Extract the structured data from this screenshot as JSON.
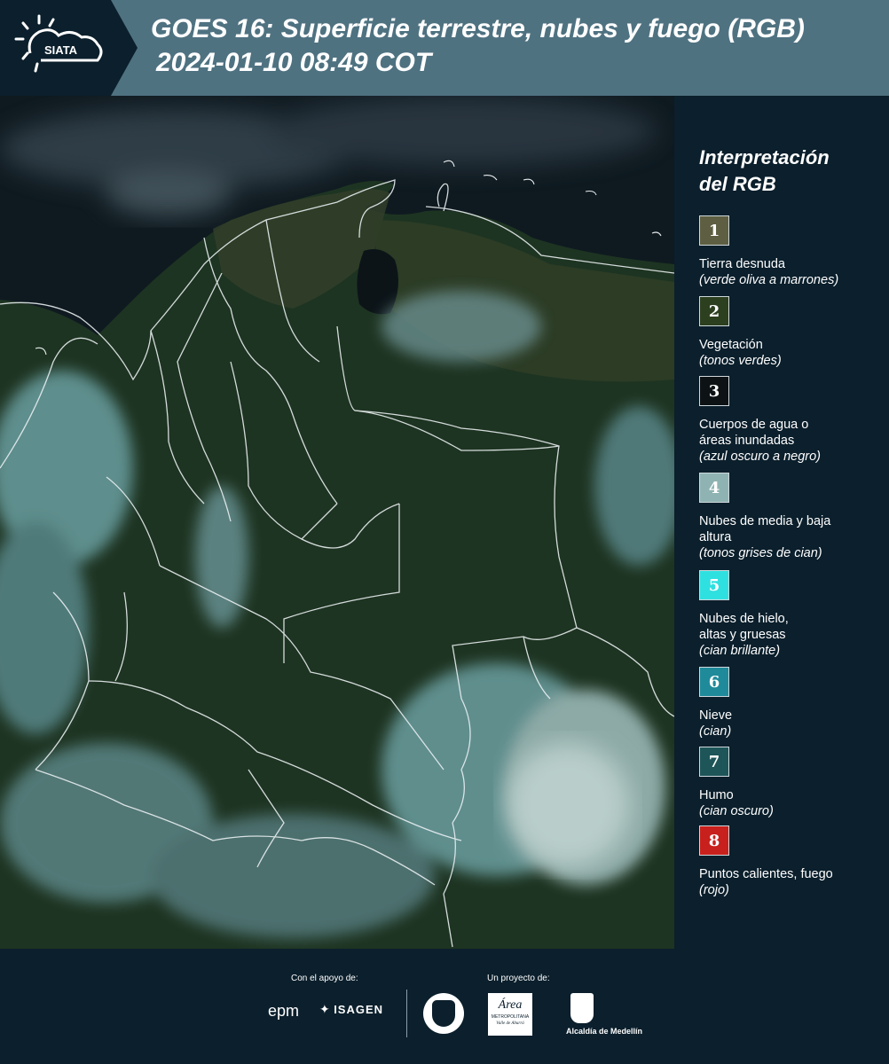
{
  "header": {
    "logo_text": "SIATA",
    "title_line1": "GOES 16: Superficie terrestre, nubes y fuego (RGB)",
    "title_line2": "2024-01-10 08:49 COT"
  },
  "legend": {
    "title_line1": "Interpretación",
    "title_line2": "del RGB",
    "items": [
      {
        "num": "1",
        "label": "Tierra desnuda",
        "sub": "(verde oliva a marrones)",
        "color": "#5e5e42"
      },
      {
        "num": "2",
        "label": "Vegetación",
        "sub": "(tonos verdes)",
        "color": "#2c3f1f"
      },
      {
        "num": "3",
        "label": "Cuerpos de agua o áreas inundadas",
        "sub": "(azul oscuro a negro)",
        "color": "#0d1215"
      },
      {
        "num": "4",
        "label": "Nubes de media y baja altura",
        "sub": "(tonos grises de cian)",
        "color": "#8fb3b3"
      },
      {
        "num": "5",
        "label": "Nubes de hielo, altas y gruesas",
        "sub": "(cian brillante)",
        "color": "#2fe0e0"
      },
      {
        "num": "6",
        "label": "Nieve",
        "sub": "(cian)",
        "color": "#1f8a9a"
      },
      {
        "num": "7",
        "label": "Humo",
        "sub": "(cian oscuro)",
        "color": "#1d5558"
      },
      {
        "num": "8",
        "label": "Puntos calientes, fuego",
        "sub": "(rojo)",
        "color": "#c8201c"
      }
    ]
  },
  "footer": {
    "support_label": "Con el apoyo de:",
    "project_label": "Un proyecto de:",
    "logo_epm": "epm",
    "logo_isagen": "ISAGEN",
    "logo_area_line1": "Área",
    "logo_area_line2": "METROPOLITANA",
    "logo_area_line3": "Valle de Aburrá",
    "logo_alcaldia": "Alcaldía de Medellín"
  }
}
